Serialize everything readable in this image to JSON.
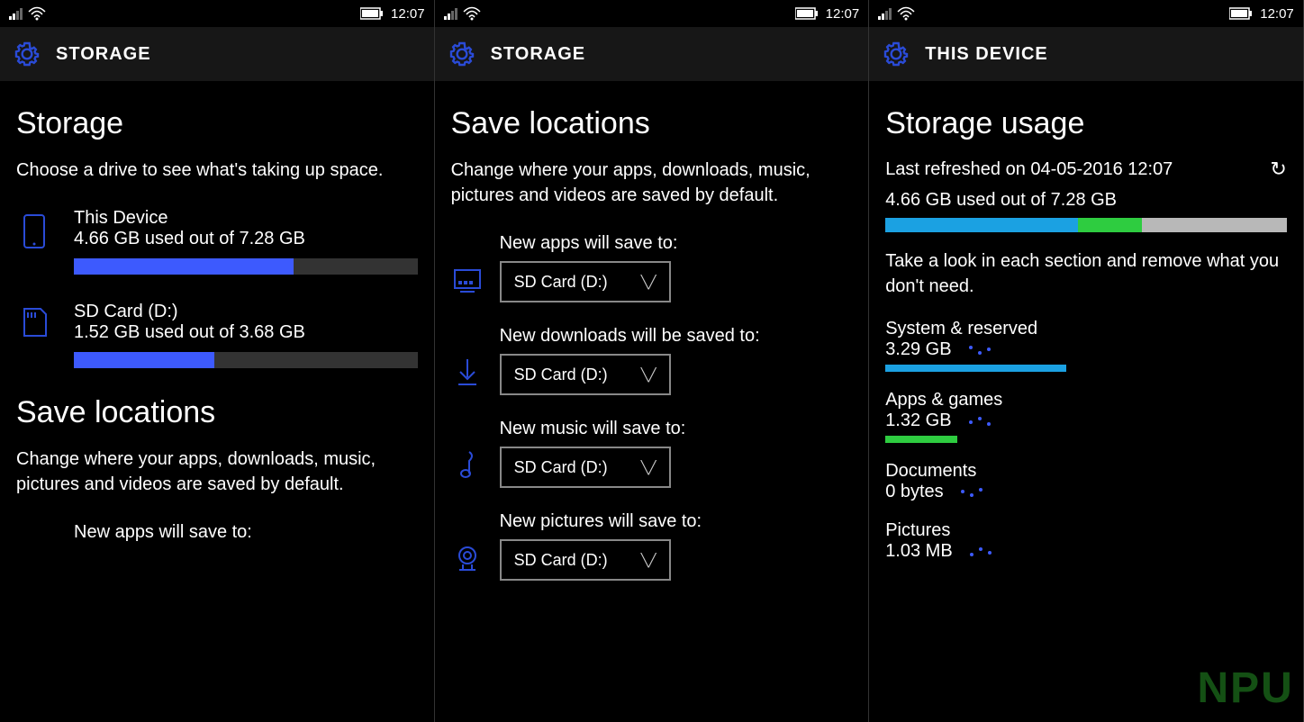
{
  "statusbar": {
    "time": "12:07"
  },
  "pane1": {
    "header": "STORAGE",
    "title": "Storage",
    "subtitle": "Choose a drive to see what's taking up space.",
    "drives": [
      {
        "name": "This Device",
        "used_text": "4.66 GB used out of 7.28 GB",
        "pct": 64
      },
      {
        "name": "SD Card (D:)",
        "used_text": "1.52 GB used out of 3.68 GB",
        "pct": 41
      }
    ],
    "section2_title": "Save locations",
    "section2_sub": "Change where your apps, downloads, music, pictures and videos are saved by default.",
    "first_label": "New apps will save to:"
  },
  "pane2": {
    "header": "STORAGE",
    "title": "Save locations",
    "subtitle": "Change where your apps, downloads, music, pictures and videos are saved by default.",
    "items": [
      {
        "label": "New apps will save to:",
        "value": "SD Card (D:)"
      },
      {
        "label": "New downloads will be saved to:",
        "value": "SD Card (D:)"
      },
      {
        "label": "New music will save to:",
        "value": "SD Card (D:)"
      },
      {
        "label": "New pictures will save to:",
        "value": "SD Card (D:)"
      }
    ]
  },
  "pane3": {
    "header": "THIS DEVICE",
    "title": "Storage usage",
    "refreshed": "Last refreshed on 04-05-2016 12:07",
    "summary": "4.66 GB used out of 7.28 GB",
    "seg1_pct": 48,
    "seg2_pct": 16,
    "help": "Take a look in each section and remove what you don't need.",
    "categories": [
      {
        "name": "System & reserved",
        "size": "3.29 GB",
        "color": "#1ba1e2",
        "pct": 45
      },
      {
        "name": "Apps & games",
        "size": "1.32 GB",
        "color": "#2ecc40",
        "pct": 18
      },
      {
        "name": "Documents",
        "size": "0 bytes",
        "color": "#999",
        "pct": 0
      },
      {
        "name": "Pictures",
        "size": "1.03 MB",
        "color": "#999",
        "pct": 0
      }
    ]
  },
  "watermark": "NPU"
}
